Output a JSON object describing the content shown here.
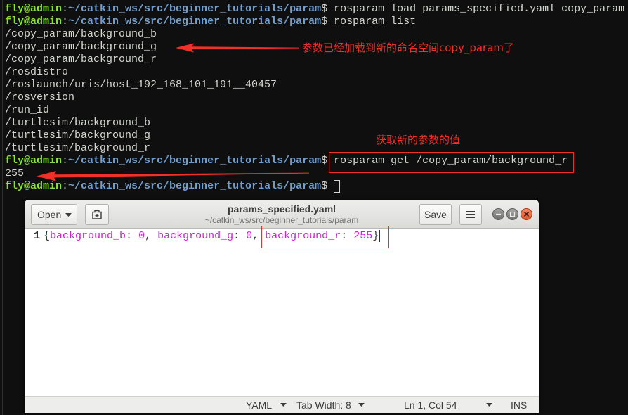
{
  "terminal": {
    "prompt": {
      "user_host": "fly@admin",
      "colon": ":",
      "path": "~/catkin_ws/src/beginner_tutorials/param",
      "symbol": "$"
    },
    "commands": {
      "load": "rosparam load params_specified.yaml copy_param",
      "list": "rosparam list",
      "get": "rosparam get /copy_param/background_r"
    },
    "list_output": [
      "/copy_param/background_b",
      "/copy_param/background_g",
      "/copy_param/background_r",
      "/rosdistro",
      "/roslaunch/uris/host_192_168_101_191__40457",
      "/rosversion",
      "/run_id",
      "/turtlesim/background_b",
      "/turtlesim/background_g",
      "/turtlesim/background_r"
    ],
    "get_output": "255"
  },
  "annotations": {
    "loaded_note": "参数已经加载到新的命名空间copy_param了",
    "get_note": "获取新的参数的值"
  },
  "gedit": {
    "open_label": "Open",
    "title": "params_specified.yaml",
    "subtitle": "~/catkin_ws/src/beginner_tutorials/param",
    "save_label": "Save",
    "editor": {
      "line_number": "1",
      "brace_open": "{",
      "brace_close": "}",
      "colon": ":",
      "comma": ",",
      "entries": [
        {
          "key": "background_b",
          "value": "0"
        },
        {
          "key": "background_g",
          "value": "0"
        },
        {
          "key": "background_r",
          "value": "255"
        }
      ]
    },
    "statusbar": {
      "language": "YAML",
      "tab_width": "Tab Width: 8",
      "cursor_position": "Ln 1, Col 54",
      "insert_mode": "INS"
    }
  },
  "icons": {
    "open_menu": "chevron-down-icon",
    "new_tab": "new-document-icon",
    "main_menu": "hamburger-menu-icon",
    "minimize": "minimize-icon",
    "maximize": "maximize-icon",
    "close": "close-icon",
    "annotation": "arrow-left-icon"
  },
  "colors": {
    "terminal_bg": "#0f0f0f",
    "terminal_text": "#d3d7cf",
    "prompt_user": "#8ae234",
    "prompt_path": "#729fcf",
    "annotation": "#f2302a",
    "yaml_token": "#d11fd3",
    "close_button": "#ef5c2e"
  }
}
